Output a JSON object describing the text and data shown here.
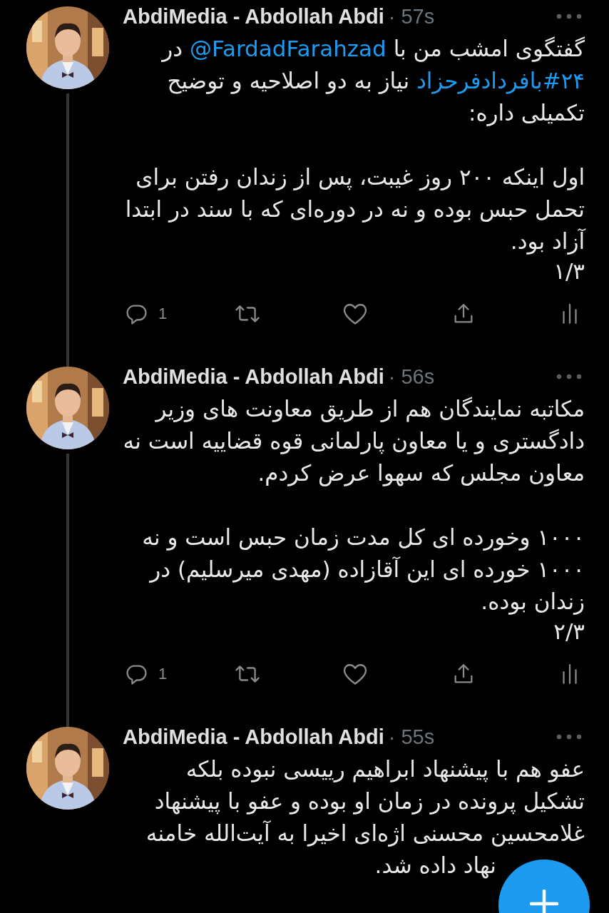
{
  "tweets": [
    {
      "author": "AbdiMedia - Abdollah Abdi",
      "time": "· 57s",
      "thread_line": true,
      "paragraphs": [
        [
          {
            "kind": "text",
            "text": "گفتگوی امشب من با "
          },
          {
            "kind": "mention",
            "text": "@FardadFarahzad"
          },
          {
            "kind": "text",
            "text": " در "
          },
          {
            "kind": "hashtag",
            "text": "#۲۴بافردادفرحزاد"
          },
          {
            "kind": "text",
            "text": " نیاز به دو اصلاحیه و توضیح تکمیلی داره:"
          }
        ],
        [
          {
            "kind": "text",
            "text": "اول اینکه ۲۰۰ روز غیبت، پس از زندان رفتن برای تحمل حبس بوده و نه در دوره‌ای که با سند در ابتدا آزاد بود."
          }
        ]
      ],
      "counter": "۱/۳",
      "reply_count": "1"
    },
    {
      "author": "AbdiMedia - Abdollah Abdi",
      "time": "· 56s",
      "thread_line": true,
      "paragraphs": [
        [
          {
            "kind": "text",
            "text": "مکاتبه نمایندگان هم از طریق معاونت های وزیر دادگستری و یا معاون پارلمانی قوه قضاییه  است نه معاون مجلس که سهوا عرض کردم."
          }
        ],
        [
          {
            "kind": "text",
            "text": "۱۰۰۰ وخورده ای کل مدت زمان حبس است و نه ۱۰۰۰ خورده ای این  آقازاده (مهدی میرسلیم) در زندان بوده."
          }
        ]
      ],
      "counter": "۲/۳",
      "reply_count": "1"
    },
    {
      "author": "AbdiMedia - Abdollah Abdi",
      "time": "· 55s",
      "thread_line": false,
      "paragraphs": [
        [
          {
            "kind": "text",
            "text": "عفو هم با پیشنهاد ابراهیم رییسی نبوده بلکه تشکیل پرونده در زمان او بوده و عفو با پیشنهاد غلامحسین محسنی اژه‌ای اخیرا به آیت‌الله خامنه"
          }
        ]
      ],
      "covered_line": "نهاد داده شد."
    }
  ]
}
